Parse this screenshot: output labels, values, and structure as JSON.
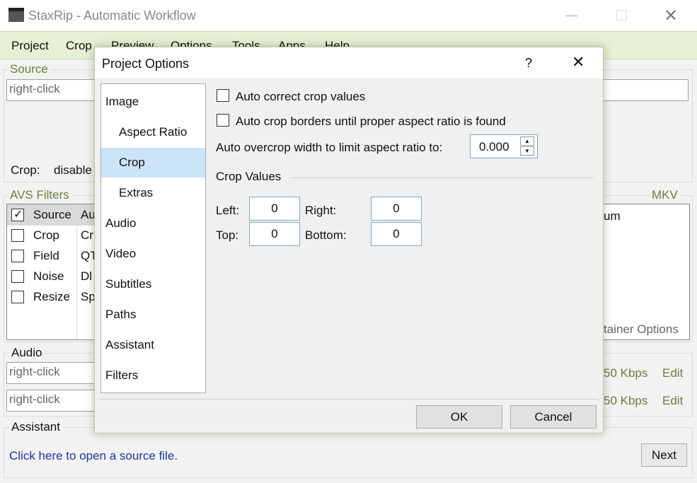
{
  "window": {
    "title": "StaxRip - Automatic Workflow"
  },
  "menu": [
    "Project",
    "Crop",
    "Preview",
    "Options",
    "Tools",
    "Apps",
    "Help"
  ],
  "main": {
    "source_label": "Source",
    "source_placeholder": "right-click",
    "crop_label": "Crop:",
    "crop_value": "disable",
    "avs_label": "AVS Filters",
    "filters": [
      {
        "name": "Source",
        "value": "Au",
        "checked": true
      },
      {
        "name": "Crop",
        "value": "Cr",
        "checked": false
      },
      {
        "name": "Field",
        "value": "QT",
        "checked": false
      },
      {
        "name": "Noise",
        "value": "Dl",
        "checked": false
      },
      {
        "name": "Resize",
        "value": "Sp",
        "checked": false
      }
    ],
    "container_label": "MKV",
    "container_text": "um",
    "container_options": "tainer Options",
    "audio_label": "Audio",
    "audio_tracks": [
      {
        "placeholder": "right-click",
        "bitrate": "50 Kbps",
        "edit": "Edit"
      },
      {
        "placeholder": "right-click",
        "bitrate": "50 Kbps",
        "edit": "Edit"
      }
    ],
    "assistant_label": "Assistant",
    "assistant_link": "Click here to open a source file.",
    "next": "Next"
  },
  "dialog": {
    "title": "Project Options",
    "help": "?",
    "nav": [
      {
        "label": "Image",
        "sub": false
      },
      {
        "label": "Aspect Ratio",
        "sub": true
      },
      {
        "label": "Crop",
        "sub": true,
        "selected": true
      },
      {
        "label": "Extras",
        "sub": true
      },
      {
        "label": "Audio",
        "sub": false
      },
      {
        "label": "Video",
        "sub": false
      },
      {
        "label": "Subtitles",
        "sub": false
      },
      {
        "label": "Paths",
        "sub": false
      },
      {
        "label": "Assistant",
        "sub": false
      },
      {
        "label": "Filters",
        "sub": false
      }
    ],
    "auto_correct": "Auto correct crop values",
    "auto_crop": "Auto crop borders until proper aspect ratio is found",
    "overcrop_label": "Auto overcrop width to limit aspect ratio to:",
    "overcrop_value": "0.000",
    "crop_values": "Crop Values",
    "left_label": "Left:",
    "left": "0",
    "right_label": "Right:",
    "right": "0",
    "top_label": "Top:",
    "top": "0",
    "bottom_label": "Bottom:",
    "bottom": "0",
    "ok": "OK",
    "cancel": "Cancel"
  },
  "colors": {
    "accent_green": "#6b7f3c",
    "menu_bg": "#e5f0d5",
    "selection": "#cce4f7",
    "link": "#1a35a8"
  }
}
